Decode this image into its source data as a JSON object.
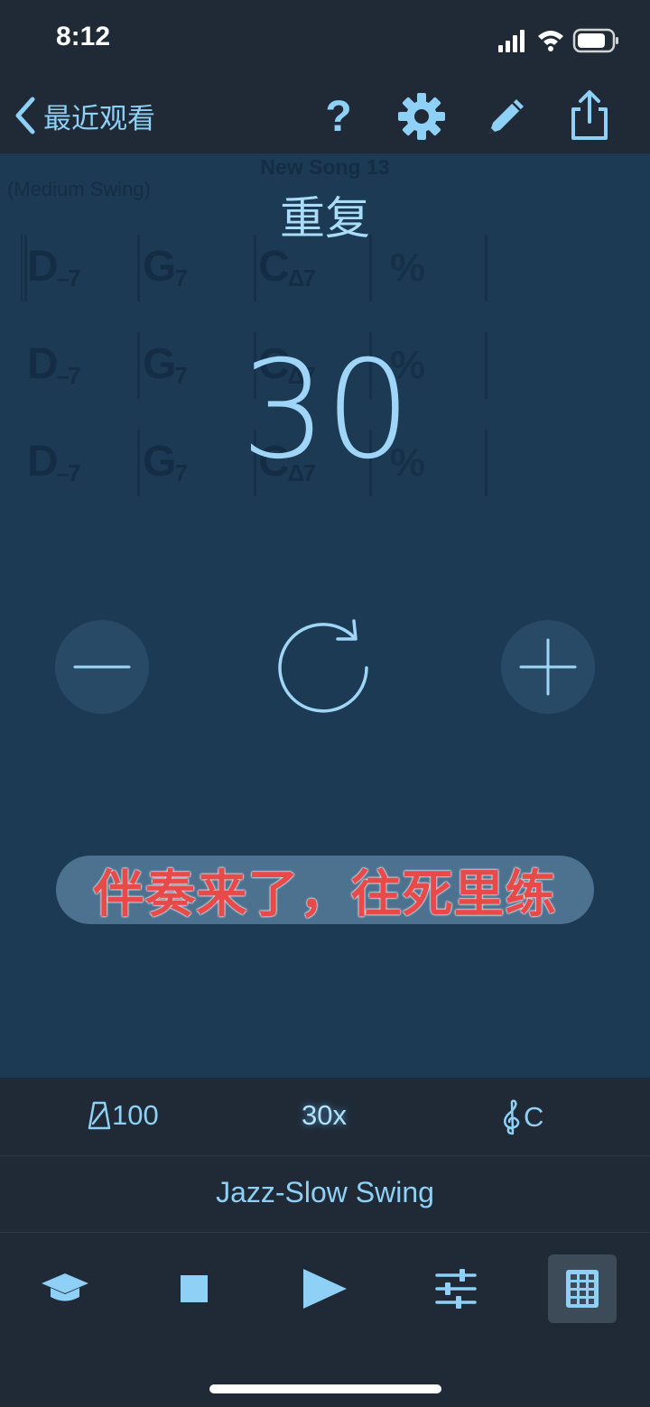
{
  "status_bar": {
    "time": "8:12"
  },
  "nav": {
    "back_label": "最近观看",
    "help_label": "?",
    "icons": [
      "chevron-left-icon",
      "gear-icon",
      "pencil-icon",
      "share-icon"
    ]
  },
  "song": {
    "title": "New Song 13",
    "style": "(Medium Swing)",
    "chords": [
      [
        {
          "root": "D",
          "quality": "–7"
        },
        {
          "root": "G",
          "quality": "7"
        },
        {
          "root": "C",
          "quality": "Δ7"
        },
        {
          "root": "%",
          "quality": ""
        }
      ],
      [
        {
          "root": "D",
          "quality": "–7"
        },
        {
          "root": "G",
          "quality": "7"
        },
        {
          "root": "C",
          "quality": "Δ7"
        },
        {
          "root": "%",
          "quality": ""
        }
      ],
      [
        {
          "root": "D",
          "quality": "–7"
        },
        {
          "root": "G",
          "quality": "7"
        },
        {
          "root": "C",
          "quality": "Δ7"
        },
        {
          "root": "%",
          "quality": ""
        }
      ]
    ]
  },
  "repeat_panel": {
    "title": "重复",
    "value": "30",
    "minus_icon": "minus-icon",
    "plus_icon": "plus-icon",
    "reset_icon": "refresh-icon"
  },
  "caption": {
    "text": "伴奏来了，往死里练"
  },
  "info_bar": {
    "tempo": "100",
    "repeats": "30x",
    "key": "C"
  },
  "style_bar": {
    "label": "Jazz-Slow Swing"
  },
  "toolbar": {
    "items": [
      "graduation-cap-icon",
      "stop-icon",
      "play-icon",
      "sliders-icon",
      "chord-chart-icon"
    ],
    "active": "chord-chart-icon"
  },
  "colors": {
    "accent": "#8ed0f6",
    "background": "#1f2a36",
    "content_bg": "#1c3a54",
    "caption_text": "#e84a4a"
  }
}
